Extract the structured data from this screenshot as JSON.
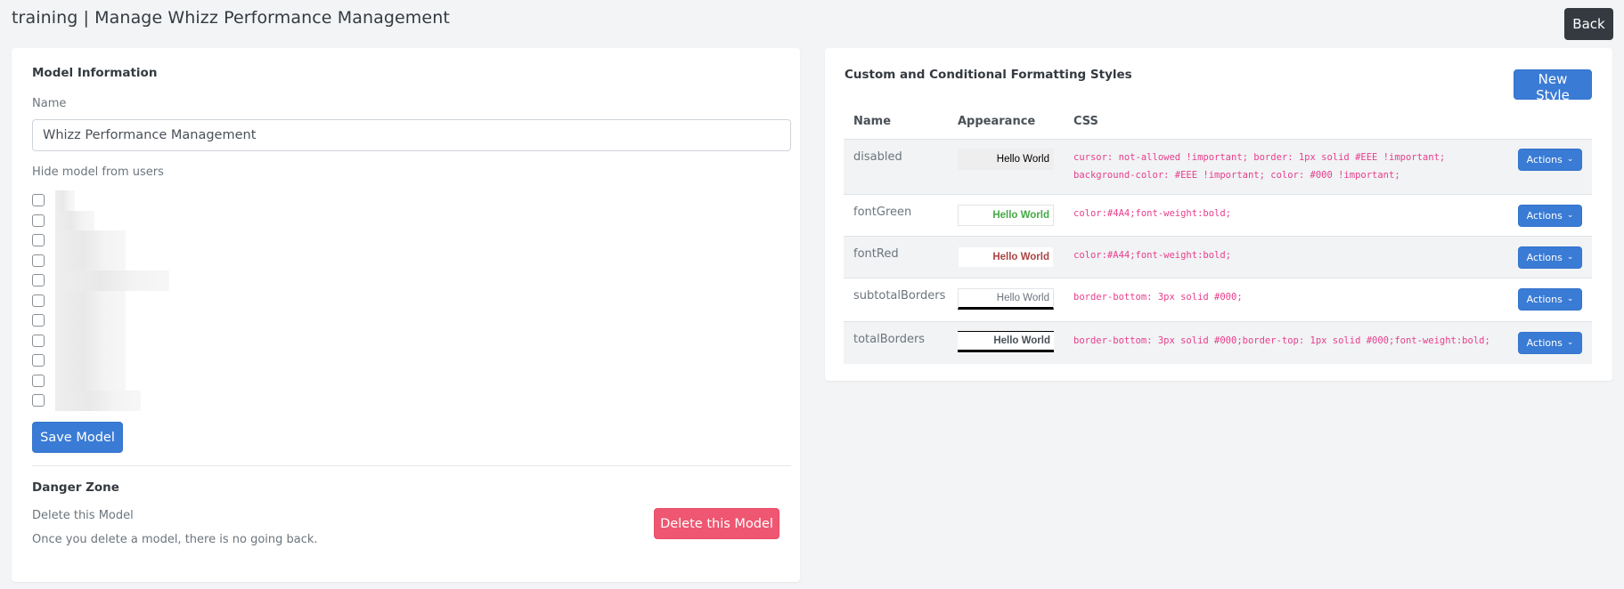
{
  "header": {
    "title": "training | Manage Whizz Performance Management",
    "back_label": "Back"
  },
  "model_info": {
    "section_title": "Model Information",
    "name_label": "Name",
    "name_value": "Whizz Performance Management",
    "hide_label": "Hide model from users",
    "users": [
      {
        "checked": false
      },
      {
        "checked": false
      },
      {
        "checked": false
      },
      {
        "checked": false
      },
      {
        "checked": false
      },
      {
        "checked": false
      },
      {
        "checked": false
      },
      {
        "checked": false
      },
      {
        "checked": false
      },
      {
        "checked": false
      },
      {
        "checked": false
      }
    ],
    "save_label": "Save Model"
  },
  "danger_zone": {
    "title": "Danger Zone",
    "subtitle": "Delete this Model",
    "warning": "Once you delete a model, there is no going back.",
    "delete_label": "Delete this Model"
  },
  "styles": {
    "title": "Custom and Conditional Formatting Styles",
    "new_label": "New Style",
    "columns": [
      "Name",
      "Appearance",
      "CSS"
    ],
    "rows": [
      {
        "name": "disabled",
        "preview": "Hello World",
        "css": "cursor: not-allowed !important; border: 1px solid #EEE !important;\nbackground-color: #EEE !important; color: #000 !important;",
        "action": "Actions"
      },
      {
        "name": "fontGreen",
        "preview": "Hello World",
        "css": "color:#4A4;font-weight:bold;",
        "action": "Actions"
      },
      {
        "name": "fontRed",
        "preview": "Hello World",
        "css": "color:#A44;font-weight:bold;",
        "action": "Actions"
      },
      {
        "name": "subtotalBorders",
        "preview": "Hello World",
        "css": "border-bottom: 3px solid #000;",
        "action": "Actions"
      },
      {
        "name": "totalBorders",
        "preview": "Hello World",
        "css": "border-bottom: 3px solid #000;border-top: 1px solid #000;font-weight:bold;",
        "action": "Actions"
      }
    ]
  },
  "colors": {
    "primary": "#3a7bd5",
    "danger": "#ef5671",
    "dark": "#343a40",
    "code": "#e83e8c"
  },
  "icons": {
    "actions_caret": "chevron-down-icon"
  }
}
